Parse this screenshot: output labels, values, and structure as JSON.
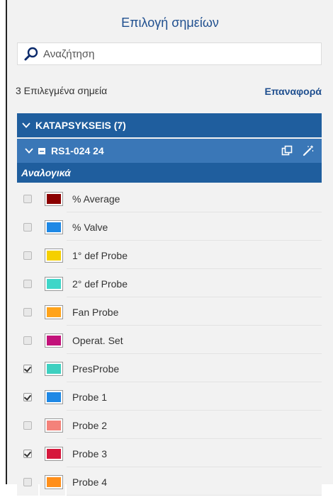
{
  "title": "Επιλογή σημείων",
  "search": {
    "placeholder": "Αναζήτηση",
    "value": ""
  },
  "selection": {
    "count_text": "3 Επιλεγμένα σημεία",
    "reset_label": "Επαναφορά"
  },
  "group": {
    "label": "KATAPSYKSEIS (7)"
  },
  "device": {
    "label": "RS1-024 24"
  },
  "section": {
    "label": "Αναλογικά"
  },
  "colors": {
    "accent": "#1f5e9e",
    "device_bar": "#3a77b7",
    "title": "#1f4f8f"
  },
  "points": [
    {
      "label": "% Average",
      "color": "#8b0000",
      "checked": false
    },
    {
      "label": "% Valve",
      "color": "#1e88e5",
      "checked": false
    },
    {
      "label": "1° def Probe",
      "color": "#f5d000",
      "checked": false
    },
    {
      "label": "2° def Probe",
      "color": "#3ed6c8",
      "checked": false
    },
    {
      "label": "Fan Probe",
      "color": "#ffa31a",
      "checked": false
    },
    {
      "label": "Operat. Set",
      "color": "#c2127a",
      "checked": false
    },
    {
      "label": "PresProbe",
      "color": "#3ed0c0",
      "checked": true
    },
    {
      "label": "Probe 1",
      "color": "#1e88e5",
      "checked": true
    },
    {
      "label": "Probe 2",
      "color": "#f4827a",
      "checked": false
    },
    {
      "label": "Probe 3",
      "color": "#d6183c",
      "checked": true
    },
    {
      "label": "Probe 4",
      "color": "#ff8f1a",
      "checked": false
    }
  ]
}
